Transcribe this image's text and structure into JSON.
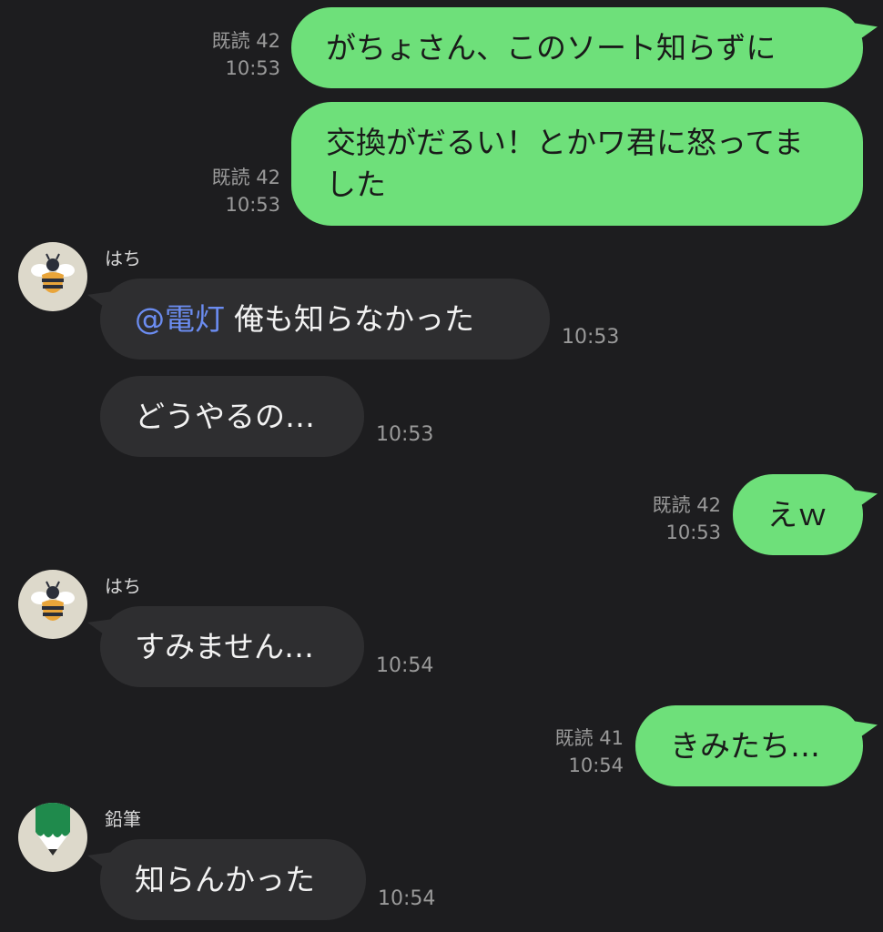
{
  "messages": [
    {
      "type": "out",
      "text": "がちょさん、このソート知らずに",
      "read": "既読 42",
      "time": "10:53"
    },
    {
      "type": "out",
      "text": "交換がだるい！とかワ君に怒ってました",
      "read": "既読 42",
      "time": "10:53"
    },
    {
      "type": "in",
      "sender": "はち",
      "avatar_icon": "bee-icon",
      "mention": "@電灯",
      "text": "俺も知らなかった",
      "time": "10:53"
    },
    {
      "type": "in",
      "text": "どうやるの…",
      "time": "10:53"
    },
    {
      "type": "out",
      "text": "えｗ",
      "read": "既読 42",
      "time": "10:53"
    },
    {
      "type": "in",
      "sender": "はち",
      "avatar_icon": "bee-icon",
      "text": "すみません…",
      "time": "10:54"
    },
    {
      "type": "out",
      "text": "きみたち…",
      "read": "既読 41",
      "time": "10:54"
    },
    {
      "type": "in",
      "sender": "鉛筆",
      "avatar_icon": "pencil-icon",
      "text": "知らんかった",
      "time": "10:54"
    }
  ],
  "colors": {
    "background": "#1d1d1f",
    "outgoing_bubble": "#6ee07a",
    "incoming_bubble": "#2e2e30",
    "mention": "#6b8cf0",
    "meta_text": "#9a9a9a"
  }
}
